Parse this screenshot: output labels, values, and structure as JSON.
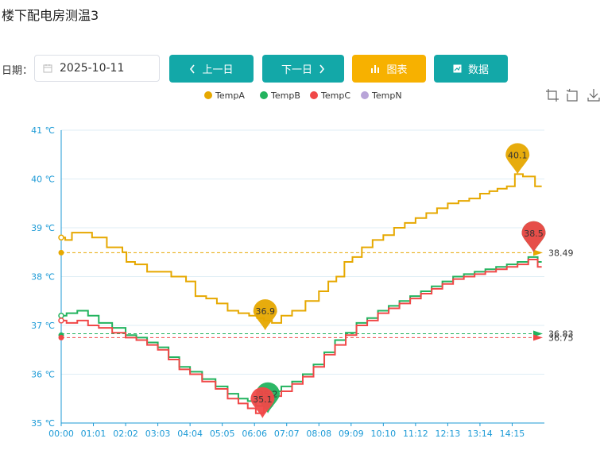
{
  "page": {
    "title": "楼下配电房测温3",
    "date_label": "日期：",
    "date_value": "2025-10-11",
    "calendar_icon": "calendar-icon"
  },
  "toolbar": {
    "prev_label": "上一日",
    "next_label": "下一日",
    "chart_label": "图表",
    "data_label": "数据",
    "prev_icon": "chevron-left-icon",
    "next_icon": "chevron-right-icon",
    "chart_icon": "bar-chart-icon",
    "data_icon": "table-icon",
    "teal_color": "#13a8a8",
    "gold_color": "#f7b100"
  },
  "chart_tools": [
    "zoom-icon",
    "restore-icon",
    "download-icon"
  ],
  "chart_data": {
    "type": "line",
    "title": "",
    "xlabel": "",
    "ylabel": "",
    "ylim": [
      35,
      41
    ],
    "yticks": [
      "35 ℃",
      "36 ℃",
      "37 ℃",
      "38 ℃",
      "39 ℃",
      "40 ℃",
      "41 ℃"
    ],
    "x_tick_labels": [
      "00:00",
      "01:01",
      "02:02",
      "03:03",
      "04:04",
      "05:05",
      "06:06",
      "07:07",
      "08:08",
      "09:09",
      "10:10",
      "11:12",
      "12:13",
      "13:14",
      "14:15"
    ],
    "x_range_minutes": [
      0,
      900
    ],
    "legend_position": "top-center",
    "grid": "horizontal",
    "series": [
      {
        "name": "TempA",
        "color": "#e6a800",
        "points": [
          [
            0,
            38.8
          ],
          [
            15,
            38.75
          ],
          [
            25,
            38.9
          ],
          [
            55,
            38.9
          ],
          [
            60,
            38.8
          ],
          [
            110,
            38.6
          ],
          [
            118,
            38.5
          ],
          [
            125,
            38.3
          ],
          [
            150,
            38.25
          ],
          [
            170,
            38.1
          ],
          [
            185,
            38.1
          ],
          [
            225,
            38.0
          ],
          [
            240,
            37.9
          ],
          [
            260,
            37.6
          ],
          [
            280,
            37.55
          ],
          [
            300,
            37.45
          ],
          [
            320,
            37.3
          ],
          [
            340,
            37.25
          ],
          [
            360,
            37.2
          ],
          [
            370,
            37.15
          ],
          [
            385,
            37.1
          ],
          [
            400,
            37.05
          ],
          [
            420,
            37.2
          ],
          [
            440,
            37.3
          ],
          [
            470,
            37.5
          ],
          [
            490,
            37.7
          ],
          [
            505,
            37.9
          ],
          [
            520,
            38.0
          ],
          [
            535,
            38.3
          ],
          [
            550,
            38.4
          ],
          [
            570,
            38.6
          ],
          [
            590,
            38.75
          ],
          [
            610,
            38.85
          ],
          [
            630,
            39.0
          ],
          [
            650,
            39.1
          ],
          [
            670,
            39.2
          ],
          [
            690,
            39.3
          ],
          [
            710,
            39.4
          ],
          [
            730,
            39.5
          ],
          [
            750,
            39.55
          ],
          [
            770,
            39.6
          ],
          [
            790,
            39.7
          ],
          [
            805,
            39.75
          ],
          [
            820,
            39.8
          ],
          [
            840,
            39.85
          ],
          [
            850,
            40.1
          ],
          [
            870,
            40.05
          ],
          [
            895,
            39.85
          ]
        ]
      },
      {
        "name": "TempB",
        "color": "#22b35e",
        "points": [
          [
            0,
            37.2
          ],
          [
            20,
            37.25
          ],
          [
            40,
            37.3
          ],
          [
            60,
            37.2
          ],
          [
            80,
            37.05
          ],
          [
            110,
            36.95
          ],
          [
            130,
            36.8
          ],
          [
            150,
            36.75
          ],
          [
            170,
            36.65
          ],
          [
            190,
            36.55
          ],
          [
            210,
            36.35
          ],
          [
            230,
            36.15
          ],
          [
            250,
            36.05
          ],
          [
            275,
            35.9
          ],
          [
            300,
            35.75
          ],
          [
            320,
            35.6
          ],
          [
            340,
            35.5
          ],
          [
            355,
            35.45
          ],
          [
            370,
            35.35
          ],
          [
            380,
            35.5
          ],
          [
            400,
            35.65
          ],
          [
            420,
            35.75
          ],
          [
            440,
            35.85
          ],
          [
            460,
            36.0
          ],
          [
            480,
            36.2
          ],
          [
            500,
            36.45
          ],
          [
            520,
            36.7
          ],
          [
            540,
            36.85
          ],
          [
            560,
            37.05
          ],
          [
            580,
            37.15
          ],
          [
            600,
            37.3
          ],
          [
            620,
            37.4
          ],
          [
            640,
            37.5
          ],
          [
            660,
            37.6
          ],
          [
            680,
            37.7
          ],
          [
            700,
            37.8
          ],
          [
            720,
            37.9
          ],
          [
            740,
            38.0
          ],
          [
            760,
            38.05
          ],
          [
            780,
            38.1
          ],
          [
            800,
            38.15
          ],
          [
            820,
            38.2
          ],
          [
            840,
            38.25
          ],
          [
            860,
            38.3
          ],
          [
            880,
            38.4
          ],
          [
            895,
            38.3
          ]
        ]
      },
      {
        "name": "TempC",
        "color": "#f04848",
        "points": [
          [
            0,
            37.1
          ],
          [
            20,
            37.05
          ],
          [
            40,
            37.1
          ],
          [
            60,
            37.0
          ],
          [
            80,
            36.95
          ],
          [
            110,
            36.85
          ],
          [
            130,
            36.75
          ],
          [
            150,
            36.7
          ],
          [
            170,
            36.6
          ],
          [
            190,
            36.5
          ],
          [
            210,
            36.3
          ],
          [
            230,
            36.1
          ],
          [
            250,
            36.0
          ],
          [
            275,
            35.85
          ],
          [
            300,
            35.7
          ],
          [
            320,
            35.5
          ],
          [
            340,
            35.4
          ],
          [
            355,
            35.3
          ],
          [
            370,
            35.2
          ],
          [
            385,
            35.35
          ],
          [
            400,
            35.55
          ],
          [
            420,
            35.65
          ],
          [
            440,
            35.8
          ],
          [
            460,
            35.95
          ],
          [
            480,
            36.15
          ],
          [
            500,
            36.4
          ],
          [
            520,
            36.6
          ],
          [
            540,
            36.8
          ],
          [
            560,
            37.0
          ],
          [
            580,
            37.1
          ],
          [
            600,
            37.25
          ],
          [
            620,
            37.35
          ],
          [
            640,
            37.45
          ],
          [
            660,
            37.55
          ],
          [
            680,
            37.65
          ],
          [
            700,
            37.75
          ],
          [
            720,
            37.85
          ],
          [
            740,
            37.95
          ],
          [
            760,
            38.0
          ],
          [
            780,
            38.05
          ],
          [
            800,
            38.1
          ],
          [
            820,
            38.15
          ],
          [
            840,
            38.2
          ],
          [
            860,
            38.25
          ],
          [
            880,
            38.35
          ],
          [
            895,
            38.2
          ]
        ]
      },
      {
        "name": "TempN",
        "color": "#b8a4d8",
        "points": []
      }
    ],
    "max_marks": [
      {
        "series": "TempA",
        "x": 850,
        "value": 40.1,
        "label": "40.1"
      },
      {
        "series": "TempB",
        "x": 880,
        "value": 38.5,
        "label": "38.5"
      },
      {
        "series": "TempC",
        "x": 880,
        "value": 38.5,
        "label": "38.5"
      }
    ],
    "min_marks": [
      {
        "series": "TempA",
        "x": 380,
        "value": 36.9,
        "label": "36.9"
      },
      {
        "series": "TempB",
        "x": 385,
        "value": 35.2,
        "label": "35.2"
      },
      {
        "series": "TempC",
        "x": 375,
        "value": 35.1,
        "label": "35.1"
      }
    ],
    "average_lines": [
      {
        "series": "TempA",
        "value": 38.49,
        "label": "38.49"
      },
      {
        "series": "TempB",
        "value": 36.83,
        "label": "36.83"
      },
      {
        "series": "TempC",
        "value": 36.75,
        "label": "36.75"
      }
    ]
  }
}
